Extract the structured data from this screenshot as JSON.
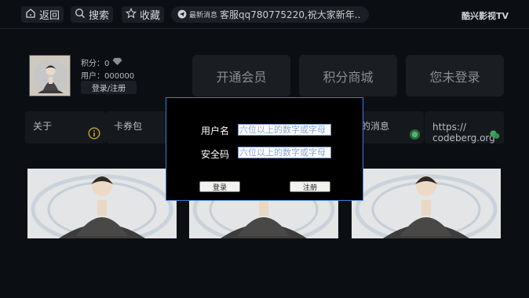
{
  "topbar": {
    "back_label": "返回",
    "search_label": "搜索",
    "favorites_label": "收藏",
    "notice_tag": "最新消息",
    "notice_text": "客服qq780775220,祝大家新年..",
    "app_title": "酷兴影视TV"
  },
  "user": {
    "points": "积分：0",
    "user_id": "用户：000000",
    "login_register": "登录/注册"
  },
  "main_buttons": [
    {
      "label": "开通会员"
    },
    {
      "label": "积分商城"
    },
    {
      "label": "您未登录"
    }
  ],
  "functions": [
    {
      "label": "关于",
      "icon": "info-icon"
    },
    {
      "label": "卡券包",
      "icon": "card-icon"
    },
    {
      "label": "",
      "icon": ""
    },
    {
      "label": "我的消息",
      "icon": "message-icon"
    },
    {
      "label": "https://\ncodeberg.org",
      "icon": "chat-icon"
    }
  ],
  "thumbnails": [
    {
      "icon": "meditating-figure-image"
    },
    {
      "icon": "meditating-figure-image"
    },
    {
      "icon": "meditating-figure-image"
    }
  ],
  "dialog": {
    "username_label": "用户名",
    "username_placeholder": "六位以上的数字或字母",
    "code_label": "安全码",
    "code_placeholder": "六位以上的数字或字母",
    "login_label": "登录",
    "register_label": "注册"
  },
  "colors": {
    "background": "#0b0f14",
    "dialog_border": "#3e7fd0",
    "info_accent": "#c9a227",
    "chat_accent": "#3aa857"
  }
}
